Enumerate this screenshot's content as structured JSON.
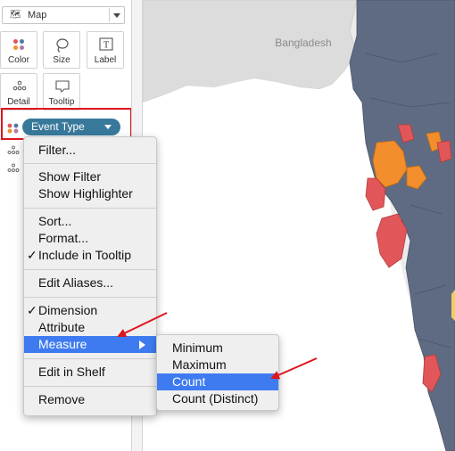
{
  "marks": {
    "mark_type": "Map",
    "buttons": [
      {
        "label": "Color"
      },
      {
        "label": "Size"
      },
      {
        "label": "Label"
      },
      {
        "label": "Detail"
      },
      {
        "label": "Tooltip"
      }
    ],
    "pill_label": "Event Type"
  },
  "map": {
    "country_label": "Bangladesh"
  },
  "context_menu": {
    "items": [
      {
        "label": "Filter..."
      },
      {
        "label": "Show Filter"
      },
      {
        "label": "Show Highlighter"
      },
      {
        "label": "Sort..."
      },
      {
        "label": "Format..."
      },
      {
        "label": "Include in Tooltip",
        "checked": true
      },
      {
        "label": "Edit Aliases..."
      },
      {
        "label": "Dimension",
        "checked": true
      },
      {
        "label": "Attribute"
      },
      {
        "label": "Measure",
        "active": true
      },
      {
        "label": "Edit in Shelf"
      },
      {
        "label": "Remove"
      }
    ]
  },
  "submenu": {
    "items": [
      {
        "label": "Minimum"
      },
      {
        "label": "Maximum"
      },
      {
        "label": "Count",
        "active": true
      },
      {
        "label": "Count (Distinct)"
      }
    ]
  },
  "colors": {
    "accent_highlight": "#3e7bf0",
    "pill": "#38799b",
    "annotation_red": "#e0141c",
    "region_dark": "#5f6b82",
    "region_orange": "#f28e2b",
    "region_red": "#e15759"
  },
  "icons": {
    "mark_select": "map-icon",
    "color": "color-dots-icon",
    "size": "size-lasso-icon",
    "label": "text-label-icon",
    "detail": "detail-dots-icon",
    "tooltip": "tooltip-bubble-icon"
  }
}
